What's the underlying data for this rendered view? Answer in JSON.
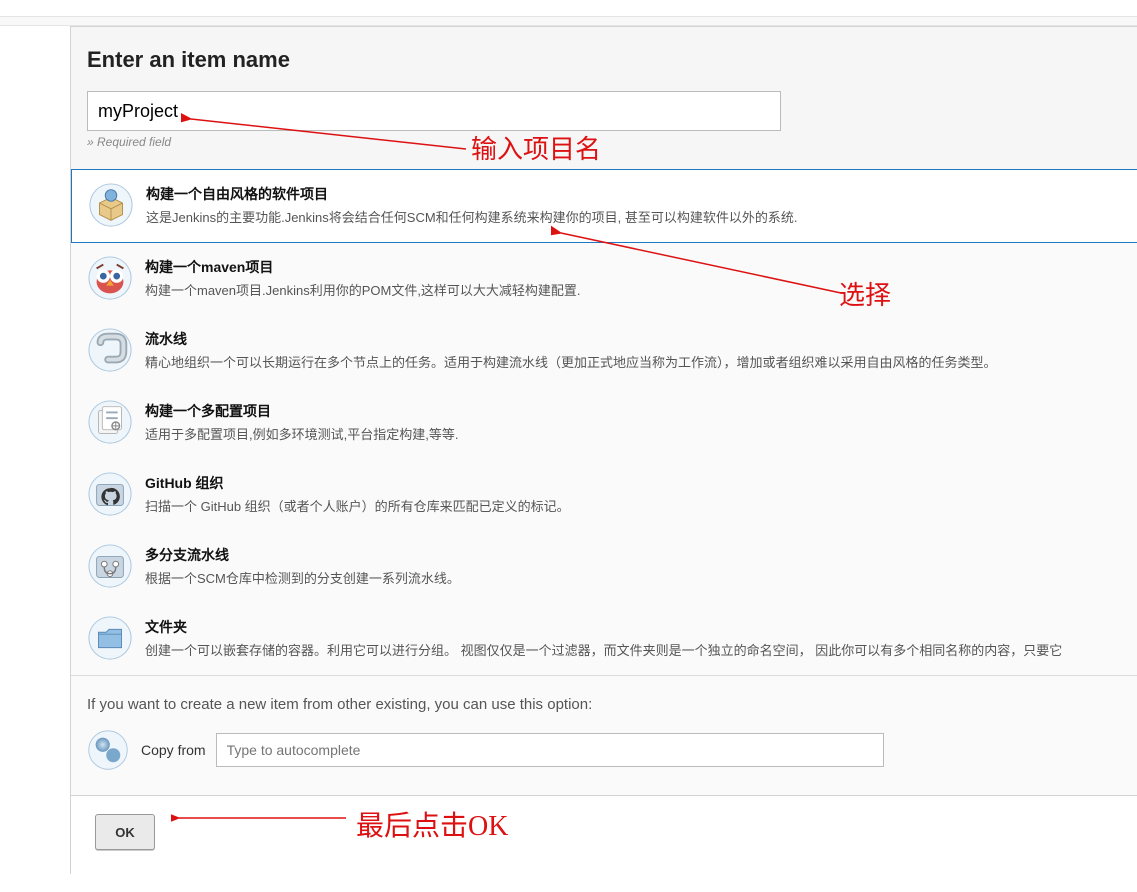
{
  "heading": "Enter an item name",
  "name_input_value": "myProject",
  "required_text": "» Required field",
  "annotations": {
    "input_name": "输入项目名",
    "select": "选择",
    "click_ok": "最后点击OK"
  },
  "options": [
    {
      "title": "构建一个自由风格的软件项目",
      "desc": "这是Jenkins的主要功能.Jenkins将会结合任何SCM和任何构建系统来构建你的项目, 甚至可以构建软件以外的系统.",
      "selected": true,
      "icon": "box"
    },
    {
      "title": "构建一个maven项目",
      "desc": "构建一个maven项目.Jenkins利用你的POM文件,这样可以大大减轻构建配置.",
      "selected": false,
      "icon": "owl"
    },
    {
      "title": "流水线",
      "desc": "精心地组织一个可以长期运行在多个节点上的任务。适用于构建流水线（更加正式地应当称为工作流），增加或者组织难以采用自由风格的任务类型。",
      "selected": false,
      "icon": "pipe"
    },
    {
      "title": "构建一个多配置项目",
      "desc": "适用于多配置项目,例如多环境测试,平台指定构建,等等.",
      "selected": false,
      "icon": "multi"
    },
    {
      "title": "GitHub 组织",
      "desc": "扫描一个 GitHub 组织（或者个人账户）的所有仓库来匹配已定义的标记。",
      "selected": false,
      "icon": "github"
    },
    {
      "title": "多分支流水线",
      "desc": "根据一个SCM仓库中检测到的分支创建一系列流水线。",
      "selected": false,
      "icon": "branch"
    },
    {
      "title": "文件夹",
      "desc": "创建一个可以嵌套存储的容器。利用它可以进行分组。 视图仅仅是一个过滤器，而文件夹则是一个独立的命名空间， 因此你可以有多个相同名称的内容，只要它",
      "selected": false,
      "icon": "folder"
    }
  ],
  "copy_section": {
    "text": "If you want to create a new item from other existing, you can use this option:",
    "label": "Copy from",
    "placeholder": "Type to autocomplete"
  },
  "ok_button": "OK"
}
